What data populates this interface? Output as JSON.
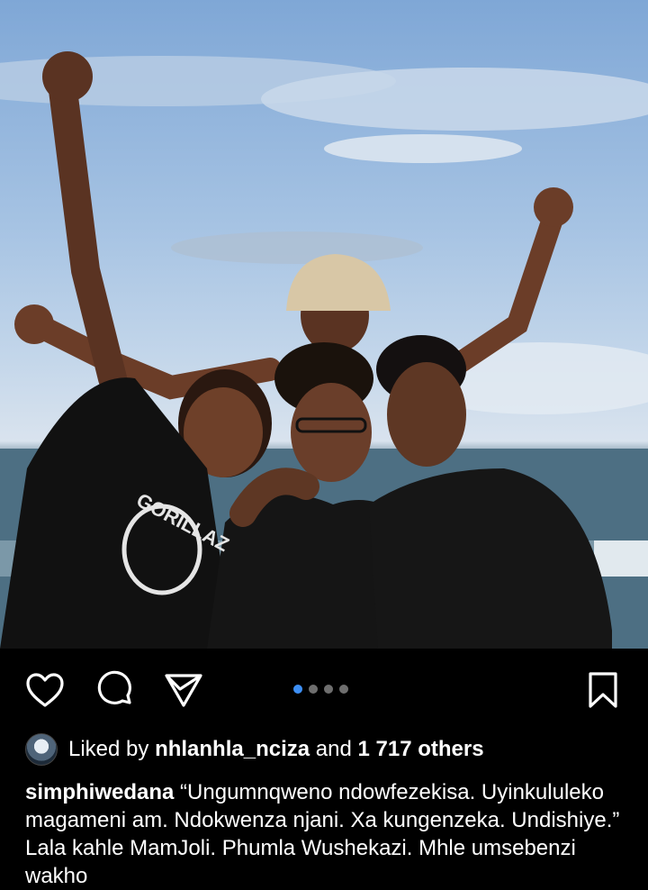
{
  "post": {
    "image_alt_icon": "photo",
    "carousel": {
      "count": 4,
      "active_index": 0
    }
  },
  "actions": {
    "like_icon": "heart-icon",
    "comment_icon": "comment-icon",
    "share_icon": "send-icon",
    "save_icon": "bookmark-icon"
  },
  "likes": {
    "prefix": "Liked by",
    "user": "nhlanhla_nciza",
    "connector": "and",
    "others": "1 717 others"
  },
  "caption": {
    "username": "simphiwedana",
    "text": "“Ungumnqweno ndowfezekisa. Uyinkululeko magameni am. Ndokwenza njani. Xa kungenzeka. Undishiye.” Lala kahle MamJoli. Phumla Wushekazi. Mhle umsebenzi wakho"
  },
  "colors": {
    "background": "#000000",
    "text": "#ffffff",
    "active_dot": "#3d8ff5",
    "inactive_dot": "#6e6e6e"
  }
}
